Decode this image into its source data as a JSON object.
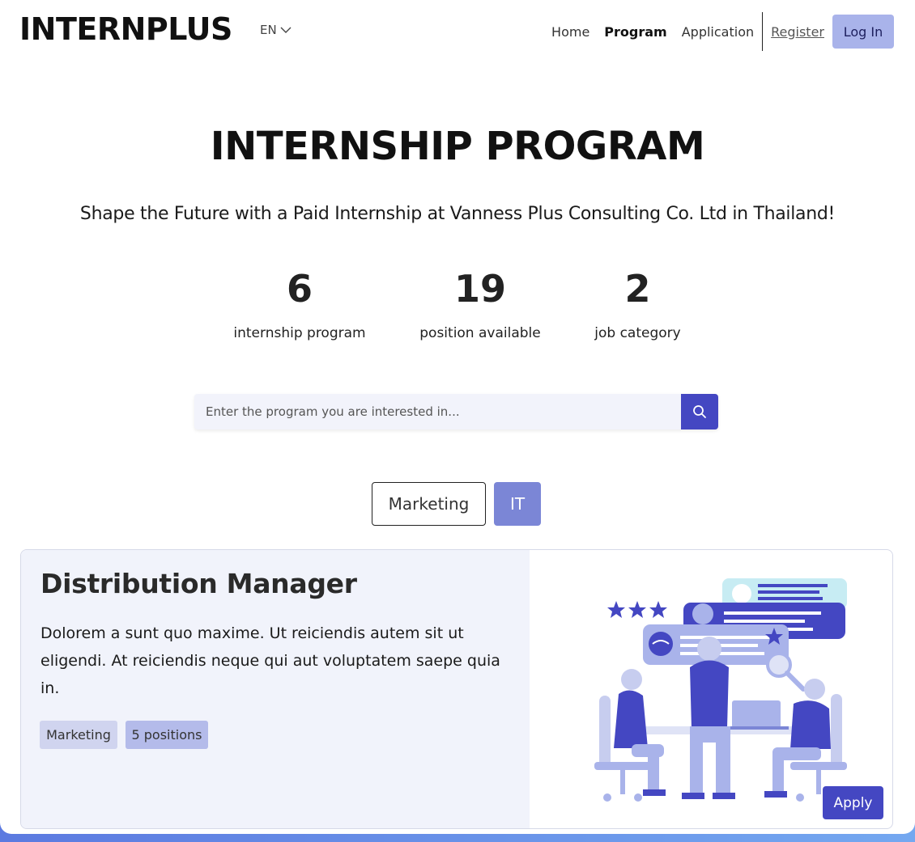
{
  "header": {
    "logo": "INTERNPLUS",
    "language": "EN",
    "nav": {
      "home": "Home",
      "program": "Program",
      "application": "Application",
      "register": "Register",
      "login": "Log In"
    }
  },
  "hero": {
    "title": "INTERNSHIP PROGRAM",
    "subtitle": "Shape the Future with a Paid Internship at Vanness Plus Consulting Co. Ltd in Thailand!"
  },
  "stats": [
    {
      "value": "6",
      "label": "internship program"
    },
    {
      "value": "19",
      "label": "position available"
    },
    {
      "value": "2",
      "label": "job category"
    }
  ],
  "search": {
    "placeholder": "Enter the program you are interested in..."
  },
  "filters": [
    {
      "label": "Marketing",
      "selected": false
    },
    {
      "label": "IT",
      "selected": true
    }
  ],
  "card": {
    "title": "Distribution Manager",
    "description": "Dolorem a sunt quo maxime. Ut reiciendis autem sit ut eligendi. At reiciendis neque qui aut voluptatem saepe quia in.",
    "tags": {
      "category": "Marketing",
      "positions": "5 positions"
    },
    "apply": "Apply",
    "illustration": "team-meeting-illustration"
  },
  "colors": {
    "primary": "#4447c2",
    "accent_light": "#a9b3ea",
    "filter_selected": "#7b86d6",
    "card_bg": "#f1f3fb"
  }
}
